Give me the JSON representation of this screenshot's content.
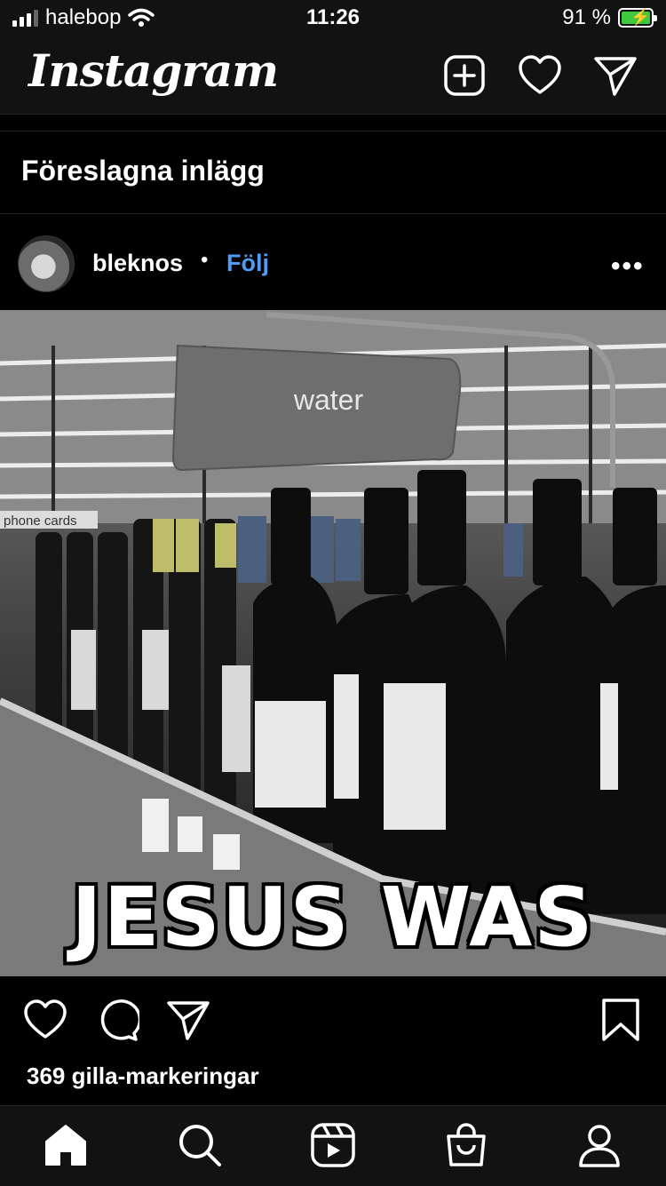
{
  "status_bar": {
    "carrier": "halebop",
    "time": "11:26",
    "battery_percent": "91 %"
  },
  "header": {
    "logo_text": "Instagram",
    "icons": [
      "new-post-icon",
      "heart-icon",
      "direct-message-icon"
    ]
  },
  "section": {
    "title": "Föreslagna inlägg"
  },
  "post": {
    "username": "bleknos",
    "separator": "•",
    "follow_label": "Följ",
    "more_label": "•••",
    "image": {
      "sign_text": "water",
      "shelf_label": "phone cards",
      "overlay_text": "JESUS WAS HERE"
    },
    "actions": [
      "like-icon",
      "comment-icon",
      "share-icon",
      "bookmark-icon"
    ],
    "likes_text": "369 gilla-markeringar"
  },
  "tab_bar": {
    "items": [
      "home-icon",
      "search-icon",
      "reels-icon",
      "shop-icon",
      "profile-icon"
    ]
  },
  "colors": {
    "background": "#000000",
    "bar_background": "#121212",
    "follow_blue": "#4f9cf5",
    "battery_green": "#3ec93e"
  }
}
